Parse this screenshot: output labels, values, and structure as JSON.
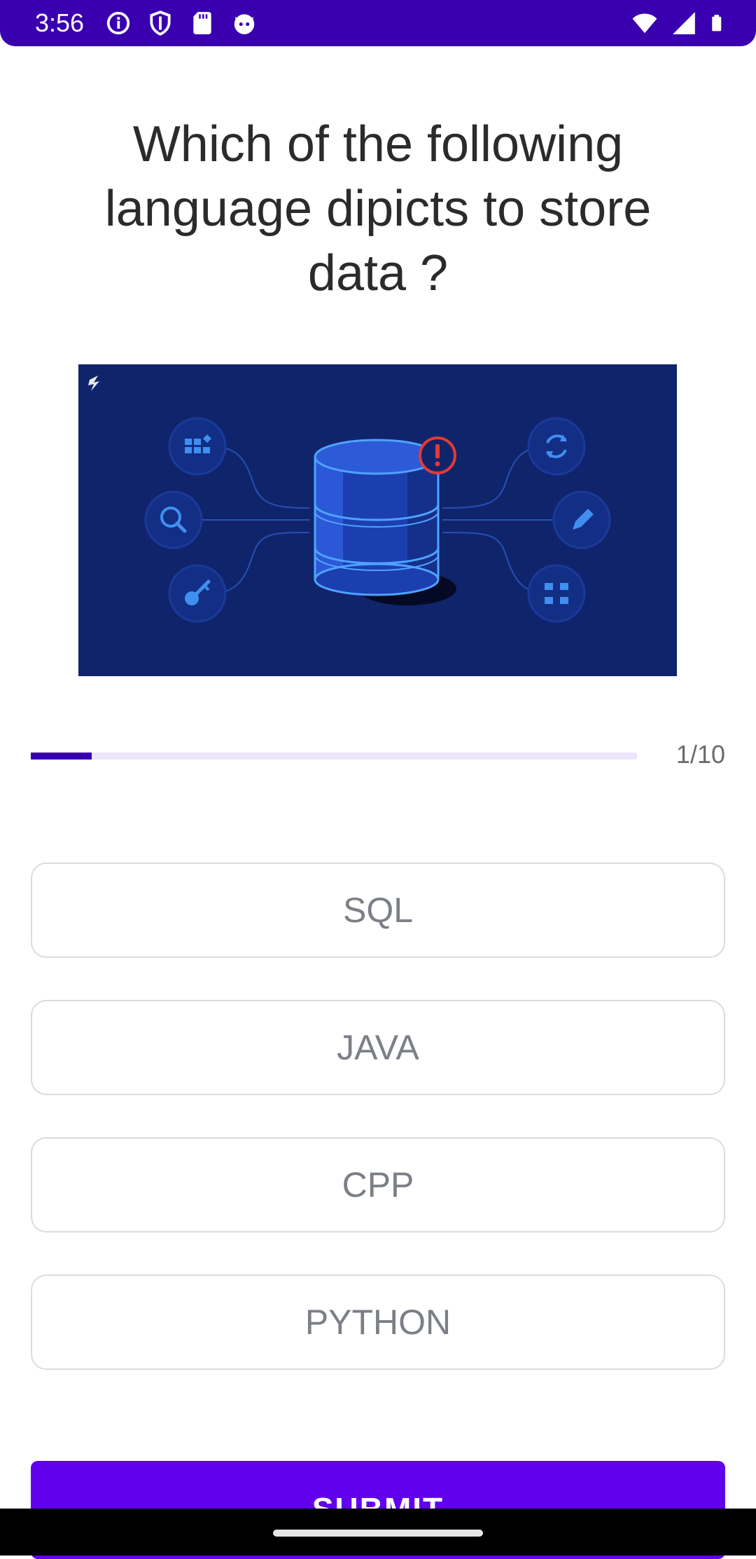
{
  "status_bar": {
    "time": "3:56",
    "left_icons": [
      "info-icon",
      "shield-icon",
      "sd-card-icon",
      "cat-face-icon"
    ],
    "right_icons": [
      "wifi-icon",
      "signal-icon",
      "battery-icon"
    ]
  },
  "quiz": {
    "question": "Which of the following language dipicts to store data ?",
    "image": "database-illustration",
    "progress": {
      "current": 1,
      "total": 10,
      "fraction": 0.1,
      "label": "1/10"
    },
    "options": [
      "SQL",
      "JAVA",
      "CPP",
      "PYTHON"
    ],
    "submit_label": "SUBMIT"
  },
  "colors": {
    "primary": "#6200ee",
    "status_bar": "#3a00b0",
    "progress_track": "#ede5fb",
    "illustration_bg": "#10246b",
    "alert_red": "#e53935"
  }
}
